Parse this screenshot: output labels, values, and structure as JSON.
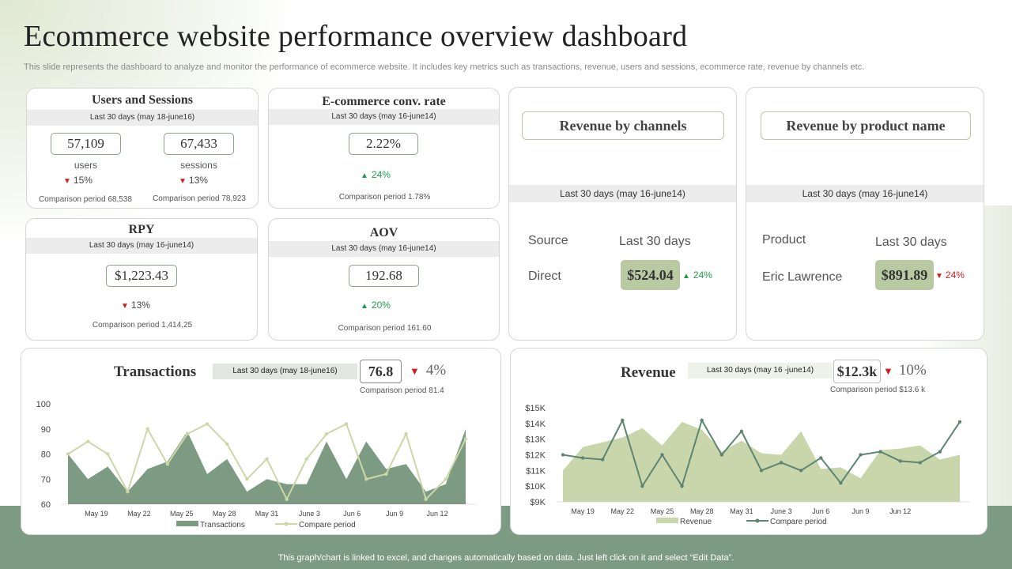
{
  "header": {
    "title": "Ecommerce website performance overview dashboard",
    "subtitle": "This slide represents the dashboard to analyze and monitor the performance of ecommerce website. It includes key metrics such as transactions, revenue, users and sessions, ecommerce rate, revenue by channels etc."
  },
  "users_sessions": {
    "title": "Users and Sessions",
    "period": "Last 30 days (may 18-june16)",
    "users": {
      "value": "57,109",
      "label": "users",
      "delta": "15%",
      "comparison": "Comparison period 68,538"
    },
    "sessions": {
      "value": "67,433",
      "label": "sessions",
      "delta": "13%",
      "comparison": "Comparison period 78,923"
    }
  },
  "conv_rate": {
    "title": "E-commerce conv. rate",
    "period": "Last 30 days (may 16-june14)",
    "value": "2.22%",
    "delta": "24%",
    "comparison": "Comparison period 1.78%"
  },
  "rpy": {
    "title": "RPY",
    "period": "Last 30 days (may 16-june14)",
    "value": "$1,223.43",
    "delta": "13%",
    "comparison": "Comparison period 1,414,25"
  },
  "aov": {
    "title": "AOV",
    "period": "Last 30 days (may 16-june14)",
    "value": "192.68",
    "delta": "20%",
    "comparison": "Comparison period 161.60"
  },
  "revenue_channels": {
    "title": "Revenue by channels",
    "period": "Last 30 days (may 16-june14)",
    "col1_header": "Source",
    "col2_header": "Last 30 days",
    "row_label": "Direct",
    "value": "$524.04",
    "delta": "24%"
  },
  "revenue_product": {
    "title": "Revenue by product name",
    "period": "Last 30 days (may 16-june14)",
    "col1_header": "Product",
    "col2_header": "Last 30 days",
    "row_label": "Eric Lawrence",
    "value": "$891.89",
    "delta": "24%"
  },
  "transactions": {
    "title": "Transactions",
    "period": "Last 30 days (may 18-june16)",
    "value": "76.8",
    "delta": "4%",
    "comparison": "Comparison period 81.4"
  },
  "revenue": {
    "title": "Revenue",
    "period": "Last 30 days (may 16 -june14)",
    "value": "$12.3k",
    "delta": "10%",
    "comparison": "Comparison period $13.6 k"
  },
  "footer": {
    "note": "This graph/chart is linked to excel,  and changes automatically based on data. Just left click on it and select “Edit Data”."
  },
  "colors": {
    "accent_dark": "#7d9a83",
    "accent_light": "#c9d6ab",
    "down": "#cc1f1f",
    "up": "#1f9a4a"
  },
  "chart_data": [
    {
      "type": "area",
      "ylim": [
        60,
        100
      ],
      "yticks": [
        "100",
        "90",
        "80",
        "70",
        "60"
      ],
      "ytick_values": [
        100,
        90,
        80,
        70,
        60
      ],
      "xtick_labels": [
        "May 19",
        "May 22",
        "May 25",
        "May 28",
        "May 31",
        "June 3",
        "Jun 6",
        "Jun 9",
        "Jun 12"
      ],
      "xtick_index": [
        2,
        5,
        8,
        11,
        14,
        17,
        20,
        23,
        26
      ],
      "series": [
        {
          "name": "Transactions",
          "kind": "area",
          "color": "#7d9a83",
          "values": [
            80,
            70,
            75,
            65,
            74,
            77,
            89,
            72,
            78,
            65,
            70,
            68,
            68,
            85,
            70,
            85,
            74,
            76,
            65,
            68,
            90
          ]
        },
        {
          "name": "Compare period",
          "kind": "line",
          "color": "#ccd7a8",
          "values": [
            80,
            85,
            80,
            65,
            90,
            76,
            88,
            92,
            84,
            70,
            78,
            62,
            78,
            88,
            92,
            70,
            72,
            88,
            62,
            70,
            86
          ]
        }
      ]
    },
    {
      "type": "area",
      "ylim": [
        9,
        15
      ],
      "yticks": [
        "$15K",
        "$14K",
        "$13K",
        "$12K",
        "$11K",
        "$10K",
        "$9K"
      ],
      "ytick_values": [
        15,
        14,
        13,
        12,
        11,
        10,
        9
      ],
      "xtick_labels": [
        "May 19",
        "May 22",
        "May 25",
        "May 28",
        "May 31",
        "June 3",
        "Jun 6",
        "Jun 9",
        "Jun 12"
      ],
      "xtick_index": [
        1,
        3,
        5,
        7,
        9,
        11,
        13,
        15,
        17
      ],
      "series": [
        {
          "name": "Revenue",
          "kind": "area",
          "color": "#c9d6ab",
          "values": [
            11,
            12.5,
            12.8,
            13.1,
            13.7,
            12.6,
            14.1,
            13.6,
            12.2,
            12.9,
            12.1,
            12.0,
            13.5,
            11.1,
            11.2,
            10.5,
            12.3,
            12.4,
            12.6,
            11.7,
            12.0
          ]
        },
        {
          "name": "Compare period",
          "kind": "line",
          "color": "#5e8472",
          "values": [
            12.0,
            11.8,
            11.7,
            14.2,
            10.0,
            12.0,
            10.0,
            14.2,
            12.0,
            13.5,
            11.0,
            11.5,
            11.0,
            11.8,
            10.2,
            12.0,
            12.2,
            11.6,
            11.5,
            12.2,
            14.1
          ]
        }
      ]
    }
  ]
}
